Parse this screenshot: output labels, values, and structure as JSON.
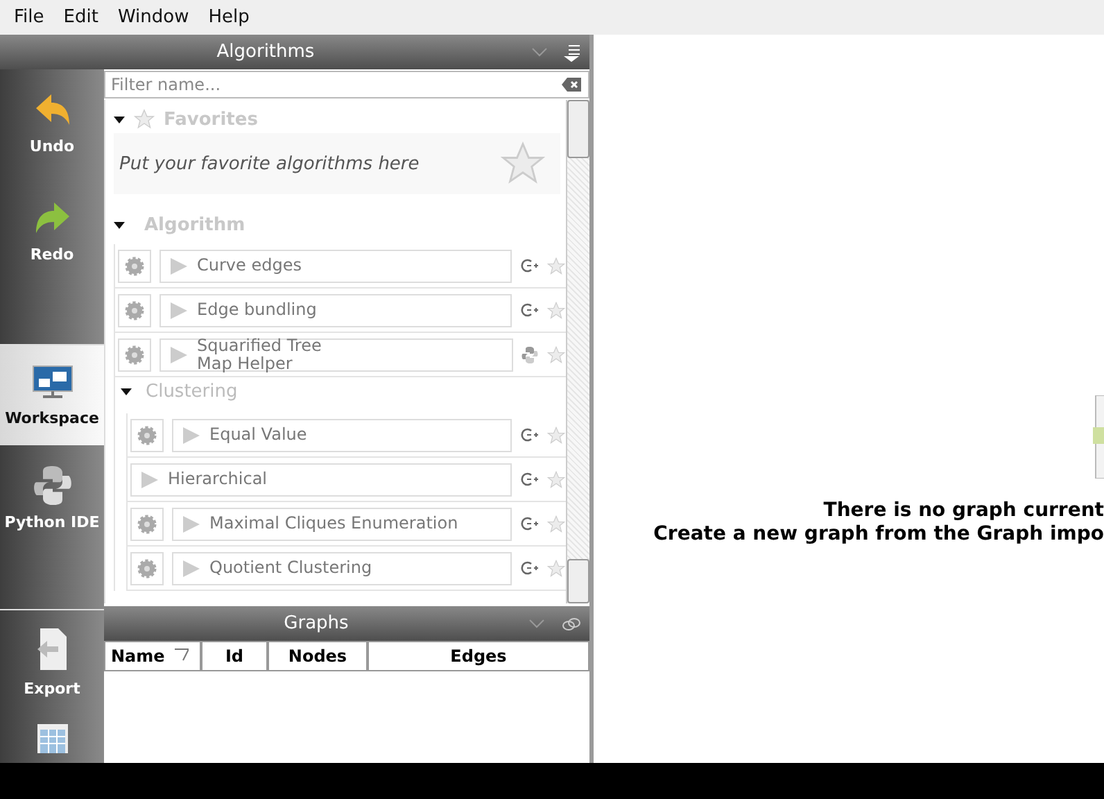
{
  "menu": [
    "File",
    "Edit",
    "Window",
    "Help"
  ],
  "sidebar": {
    "items": [
      {
        "label": "Undo",
        "kind": "undo",
        "selected": false
      },
      {
        "label": "Redo",
        "kind": "redo",
        "selected": false
      },
      {
        "kind": "gap"
      },
      {
        "label": "Workspace",
        "kind": "workspace",
        "selected": true
      },
      {
        "label": "Python IDE",
        "kind": "python",
        "selected": false
      },
      {
        "kind": "gap"
      },
      {
        "label": "Export",
        "kind": "export",
        "selected": false
      },
      {
        "kind": "table"
      }
    ]
  },
  "algorithms": {
    "title": "Algorithms",
    "filter": {
      "placeholder": "Filter name..."
    },
    "favorites": {
      "title": "Favorites",
      "expanded": true,
      "hint": "Put your favorite algorithms here"
    },
    "groups": [
      {
        "title": "Algorithm",
        "expanded": true,
        "items": [
          {
            "name": "Curve edges",
            "settings": true,
            "kind": "plugin",
            "favorite": false
          },
          {
            "name": "Edge bundling",
            "settings": true,
            "kind": "plugin",
            "favorite": false
          },
          {
            "name": "Squarified Tree\nMap Helper",
            "settings": true,
            "kind": "python",
            "favorite": false
          }
        ],
        "children": [
          {
            "title": "Clustering",
            "expanded": true,
            "items": [
              {
                "name": "Equal Value",
                "settings": true,
                "kind": "plugin",
                "favorite": false
              },
              {
                "name": "Hierarchical",
                "settings": false,
                "kind": "plugin",
                "favorite": false
              },
              {
                "name": "Maximal Cliques Enumeration",
                "settings": true,
                "kind": "plugin",
                "favorite": false
              },
              {
                "name": "Quotient Clustering",
                "settings": true,
                "kind": "plugin",
                "favorite": false
              }
            ]
          }
        ]
      }
    ]
  },
  "graphs": {
    "title": "Graphs",
    "columns": [
      {
        "label": "Name",
        "sorted": true
      },
      {
        "label": "Id",
        "sorted": false
      },
      {
        "label": "Nodes",
        "sorted": false
      },
      {
        "label": "Edges",
        "sorted": false
      }
    ]
  },
  "workspace": {
    "message": [
      "There is no graph current",
      "Create a new graph from the Graph impo"
    ]
  }
}
